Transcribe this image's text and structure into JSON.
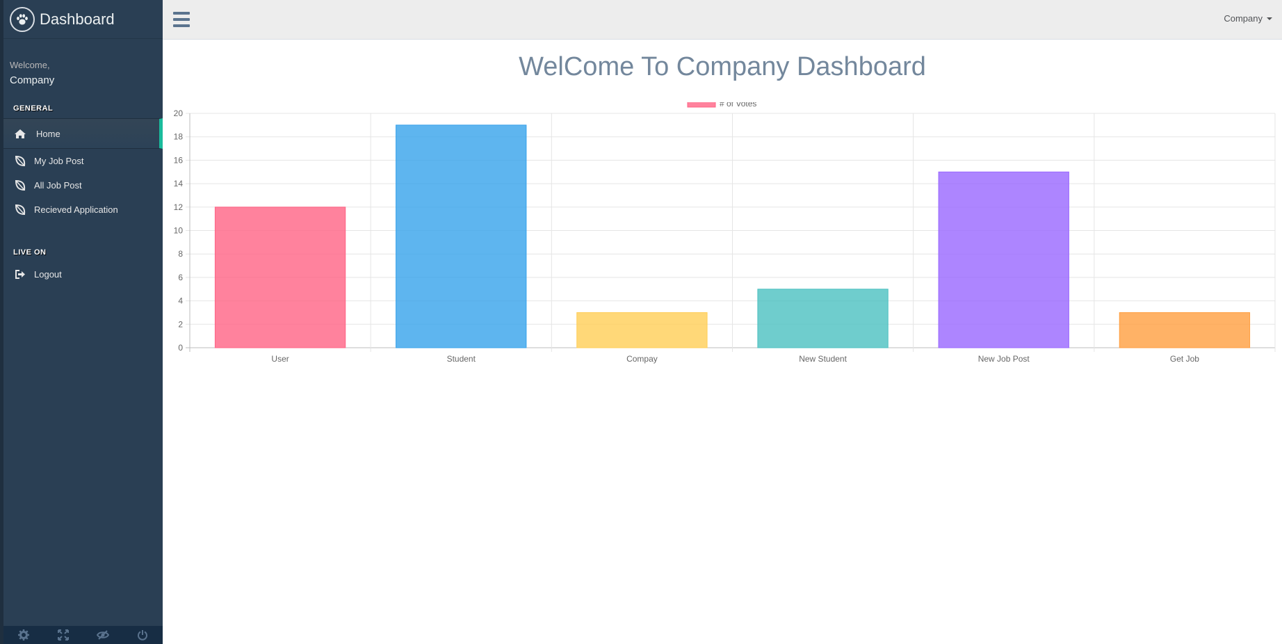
{
  "sidebar": {
    "brand": "Dashboard",
    "brand_icon": "paw-icon",
    "welcome_label": "Welcome,",
    "welcome_name": "Company",
    "section_general": "GENERAL",
    "section_live": "LIVE ON",
    "items": [
      {
        "label": "Home",
        "icon": "home-icon",
        "active": true
      },
      {
        "label": "My Job Post",
        "icon": "leaf-icon"
      },
      {
        "label": "All Job Post",
        "icon": "leaf-icon"
      },
      {
        "label": "Recieved Application",
        "icon": "leaf-icon"
      }
    ],
    "logout": {
      "label": "Logout",
      "icon": "sign-out-icon"
    },
    "footer_icons": [
      "settings-icon",
      "fullscreen-icon",
      "lock-icon",
      "power-icon"
    ]
  },
  "topnav": {
    "user_menu": "Company"
  },
  "main": {
    "title": "WelCome To Company Dashboard"
  },
  "chart_data": {
    "type": "bar",
    "categories": [
      "User",
      "Student",
      "Compay",
      "New Student",
      "New Job Post",
      "Get Job"
    ],
    "series": [
      {
        "name": "# of Votes",
        "values": [
          12,
          19,
          3,
          5,
          15,
          3
        ]
      }
    ],
    "colors": [
      "#ff6384",
      "#36a2eb",
      "#ffce56",
      "#4bc0c0",
      "#9966ff",
      "#ff9f40"
    ],
    "ylim": [
      0,
      20
    ],
    "yticks": [
      0,
      2,
      4,
      6,
      8,
      10,
      12,
      14,
      16,
      18,
      20
    ],
    "grid": true,
    "legend": "top-center"
  }
}
